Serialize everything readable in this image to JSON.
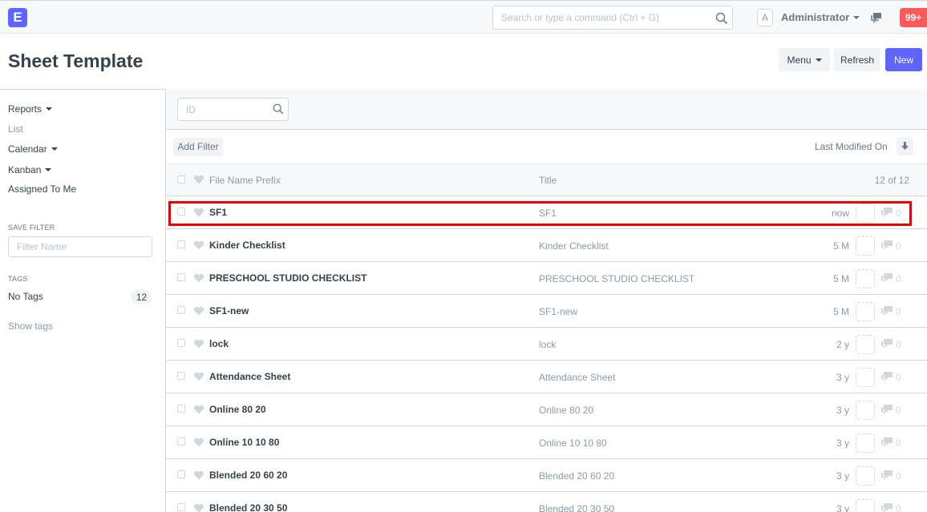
{
  "navbar": {
    "logo_letter": "E",
    "search_placeholder": "Search or type a command (Ctrl + G)",
    "avatar_letter": "A",
    "user_name": "Administrator",
    "notification_count": "99+"
  },
  "page": {
    "title": "Sheet Template",
    "menu_label": "Menu",
    "refresh_label": "Refresh",
    "new_label": "New"
  },
  "sidebar": {
    "items": [
      {
        "label": "Reports"
      },
      {
        "label": "List"
      },
      {
        "label": "Calendar"
      },
      {
        "label": "Kanban"
      },
      {
        "label": "Assigned To Me"
      }
    ],
    "save_filter_label": "SAVE FILTER",
    "filter_name_placeholder": "Filter Name",
    "tags_label": "TAGS",
    "no_tags_label": "No Tags",
    "no_tags_count": "12",
    "show_tags_label": "Show tags"
  },
  "filters": {
    "id_placeholder": "ID",
    "add_filter_label": "Add Filter",
    "sort_label": "Last Modified On"
  },
  "list": {
    "columns": {
      "name": "File Name Prefix",
      "title": "Title",
      "count": "12 of 12"
    },
    "rows": [
      {
        "name": "SF1",
        "title": "SF1",
        "modified": "now",
        "comments": "0"
      },
      {
        "name": "Kinder Checklist",
        "title": "Kinder Checklist",
        "modified": "5 M",
        "comments": "0"
      },
      {
        "name": "PRESCHOOL STUDIO CHECKLIST",
        "title": "PRESCHOOL STUDIO CHECKLIST",
        "modified": "5 M",
        "comments": "0"
      },
      {
        "name": "SF1-new",
        "title": "SF1-new",
        "modified": "5 M",
        "comments": "0"
      },
      {
        "name": "lock",
        "title": "lock",
        "modified": "2 y",
        "comments": "0"
      },
      {
        "name": "Attendance Sheet",
        "title": "Attendance Sheet",
        "modified": "3 y",
        "comments": "0"
      },
      {
        "name": "Online 80 20",
        "title": "Online 80 20",
        "modified": "3 y",
        "comments": "0"
      },
      {
        "name": "Online 10 10 80",
        "title": "Online 10 10 80",
        "modified": "3 y",
        "comments": "0"
      },
      {
        "name": "Blended 20 60 20",
        "title": "Blended 20 60 20",
        "modified": "3 y",
        "comments": "0"
      },
      {
        "name": "Blended 20 30 50",
        "title": "Blended 20 30 50",
        "modified": "3 y",
        "comments": "0"
      }
    ]
  },
  "colors": {
    "primary": "#5e64ff",
    "badge": "#ff5858",
    "highlight": "#ee0000"
  }
}
